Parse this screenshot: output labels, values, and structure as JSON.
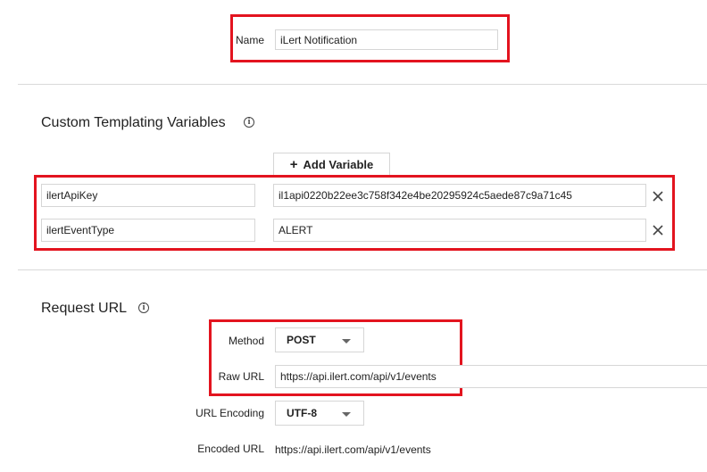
{
  "name_field": {
    "label": "Name",
    "value": "iLert Notification"
  },
  "templating": {
    "title": "Custom Templating Variables",
    "info_icon": "info-icon",
    "add_button_label": "Add Variable",
    "add_button_icon": "plus-icon",
    "variables": [
      {
        "key": "ilertApiKey",
        "value": "il1api0220b22ee3c758f342e4be20295924c5aede87c9a71c45"
      },
      {
        "key": "ilertEventType",
        "value": "ALERT"
      }
    ],
    "remove_icon": "close-icon"
  },
  "request": {
    "title": "Request URL",
    "info_icon": "info-icon",
    "method_label": "Method",
    "method_value": "POST",
    "raw_url_label": "Raw URL",
    "raw_url_value": "https://api.ilert.com/api/v1/events",
    "encoding_label": "URL Encoding",
    "encoding_value": "UTF-8",
    "encoded_url_label": "Encoded URL",
    "encoded_url_value": "https://api.ilert.com/api/v1/events"
  },
  "colors": {
    "highlight": "#e3141f",
    "border": "#d6d6d6",
    "divider": "#d9d9d9"
  }
}
